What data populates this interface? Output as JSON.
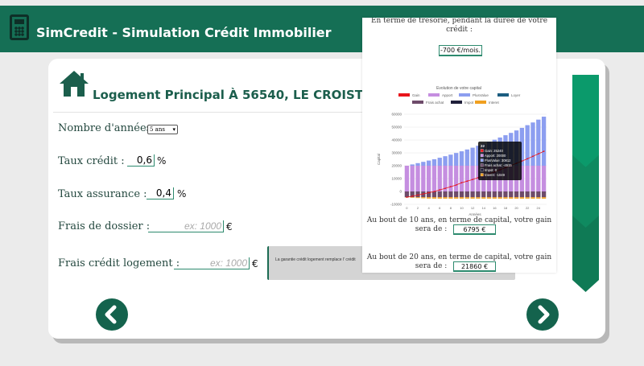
{
  "header": {
    "app_title": "SimCredit - Simulation Crédit Immobilier",
    "icon": "calculator-icon"
  },
  "page": {
    "title": "Logement Principal À 56540, LE CROISTY",
    "icon": "house-icon"
  },
  "form": {
    "years": {
      "label": "Nombre d'années :",
      "value": "5 ans"
    },
    "taux_credit": {
      "label": "Taux crédit :",
      "value": "0,6",
      "unit": "%"
    },
    "taux_assurance": {
      "label": "Taux assurance :",
      "value": "0,4",
      "unit": "%"
    },
    "frais_dossier": {
      "label": "Frais de dossier :",
      "placeholder": "ex: 1000",
      "unit": "€"
    },
    "frais_credit_logement": {
      "label": "Frais crédit logement :",
      "placeholder": "ex: 1000",
      "unit": "€"
    },
    "tooltip": "La garantie crédit logement remplace l' crédit"
  },
  "nav": {
    "prev_icon": "chevron-left-icon",
    "next_icon": "chevron-right-icon"
  },
  "panel": {
    "tresorerie_text_1": "En terme de trésorie, pendant la durée de votre",
    "tresorerie_text_2": "crédit :",
    "tresorerie_value": "-700 €/mois.",
    "gain10_text_1": "Au bout de 10 ans, en terme de capital, votre gain",
    "gain10_text_2": "sera de :",
    "gain10_value": "6795 €",
    "gain20_text_1": "Au bout de 20 ans, en terme de capital, votre gain",
    "gain20_text_2": "sera de :",
    "gain20_value": "21860 €"
  },
  "chart_data": {
    "type": "bar",
    "title": "Evolution de votre capital",
    "xlabel": "Années",
    "ylabel": "Capital",
    "ylim": [
      -10000,
      60000
    ],
    "yticks": [
      "60000",
      "50000",
      "40000",
      "30000",
      "20000",
      "10000",
      "0",
      "-10000"
    ],
    "xticks": [
      "0",
      "2",
      "4",
      "6",
      "8",
      "10",
      "12",
      "14",
      "16",
      "18",
      "20",
      "22",
      "24"
    ],
    "x": [
      0,
      1,
      2,
      3,
      4,
      5,
      6,
      7,
      8,
      9,
      10,
      11,
      12,
      13,
      14,
      15,
      16,
      17,
      18,
      19,
      20,
      21,
      22,
      23,
      24,
      25
    ],
    "legend": [
      {
        "name": "Gain",
        "color": "#e8141c"
      },
      {
        "name": "Apport",
        "color": "#c58ee0"
      },
      {
        "name": "PlusValue",
        "color": "#8c9ef0"
      },
      {
        "name": "Loyer",
        "color": "#1c5d80"
      },
      {
        "name": "Frais achat",
        "color": "#6e4b6a"
      },
      {
        "name": "Impot",
        "color": "#1f1f3a"
      },
      {
        "name": "Interet",
        "color": "#f0a020"
      }
    ],
    "series": [
      {
        "name": "Apport",
        "values": [
          20000,
          20000,
          20000,
          20000,
          20000,
          20000,
          20000,
          20000,
          20000,
          20000,
          20000,
          20000,
          20000,
          20000,
          20000,
          20000,
          20000,
          20000,
          20000,
          20000,
          20000,
          20000,
          20000,
          20000,
          20000,
          20000
        ]
      },
      {
        "name": "PlusValue",
        "values": [
          0,
          1000,
          2000,
          3000,
          4000,
          5000,
          6200,
          7400,
          8600,
          9900,
          11200,
          12600,
          14000,
          15500,
          17000,
          18600,
          20200,
          21900,
          23700,
          25500,
          27400,
          29400,
          31500,
          33600,
          35800,
          38100
        ]
      },
      {
        "name": "Frais achat",
        "values": [
          -4515,
          -4515,
          -4515,
          -4515,
          -4515,
          -4515,
          -4515,
          -4515,
          -4515,
          -4515,
          -4515,
          -4515,
          -4515,
          -4515,
          -4515,
          -4515,
          -4515,
          -4515,
          -4515,
          -4515,
          -4515,
          -4515,
          -4515,
          -4515,
          -4515,
          -4515
        ]
      },
      {
        "name": "Interet",
        "values": [
          -200,
          -400,
          -600,
          -800,
          -1000,
          -1049,
          -1049,
          -1049,
          -1049,
          -1049,
          -1049,
          -1049,
          -1049,
          -1049,
          -1049,
          -1049,
          -1049,
          -1049,
          -1049,
          -1049,
          -1049,
          -1049,
          -1049,
          -1049,
          -1049,
          -1049
        ]
      },
      {
        "name": "Gain",
        "values": [
          -4500,
          -3700,
          -2800,
          -1900,
          -1000,
          0,
          1200,
          2400,
          3700,
          5000,
          6795,
          8000,
          9300,
          10700,
          12200,
          13700,
          15200,
          16800,
          18500,
          20200,
          21860,
          23600,
          25400,
          27300,
          29200,
          31200
        ]
      }
    ],
    "tooltip": {
      "title": "22",
      "items": [
        {
          "label": "Gain: 25240",
          "color": "#e8141c"
        },
        {
          "label": "Apport: 20000",
          "color": "#c58ee0"
        },
        {
          "label": "PlusValue: 30812",
          "color": "#8c9ef0"
        },
        {
          "label": "Frais achat: -4515",
          "color": "#6e4b6a"
        },
        {
          "label": "Impot: 0",
          "color": "#1f1f3a"
        },
        {
          "label": "Interet: -1049",
          "color": "#f0a020"
        }
      ]
    }
  }
}
